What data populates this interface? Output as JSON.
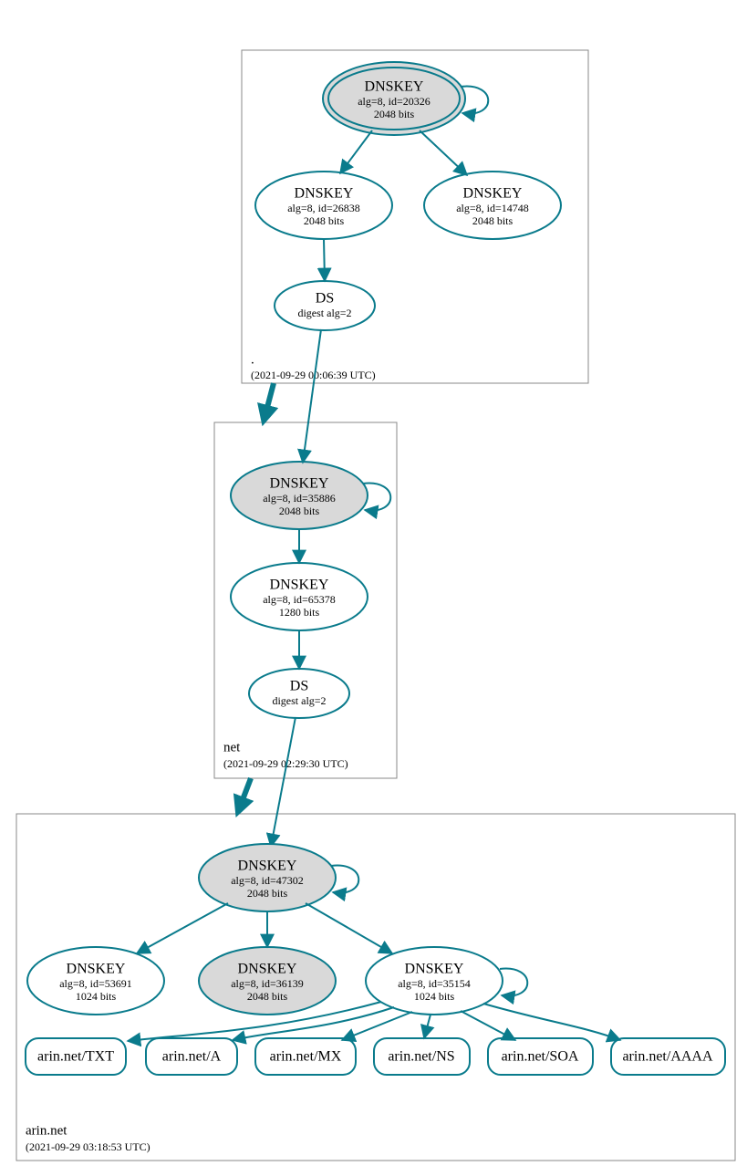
{
  "zones": {
    "root": {
      "name": ".",
      "timestamp": "(2021-09-29 00:06:39 UTC)"
    },
    "net": {
      "name": "net",
      "timestamp": "(2021-09-29 02:29:30 UTC)"
    },
    "arin": {
      "name": "arin.net",
      "timestamp": "(2021-09-29 03:18:53 UTC)"
    }
  },
  "nodes": {
    "root_ksk": {
      "title": "DNSKEY",
      "sub1": "alg=8, id=20326",
      "sub2": "2048 bits"
    },
    "root_zsk": {
      "title": "DNSKEY",
      "sub1": "alg=8, id=26838",
      "sub2": "2048 bits"
    },
    "root_other": {
      "title": "DNSKEY",
      "sub1": "alg=8, id=14748",
      "sub2": "2048 bits"
    },
    "root_ds": {
      "title": "DS",
      "sub1": "digest alg=2"
    },
    "net_ksk": {
      "title": "DNSKEY",
      "sub1": "alg=8, id=35886",
      "sub2": "2048 bits"
    },
    "net_zsk": {
      "title": "DNSKEY",
      "sub1": "alg=8, id=65378",
      "sub2": "1280 bits"
    },
    "net_ds": {
      "title": "DS",
      "sub1": "digest alg=2"
    },
    "arin_ksk": {
      "title": "DNSKEY",
      "sub1": "alg=8, id=47302",
      "sub2": "2048 bits"
    },
    "arin_k1": {
      "title": "DNSKEY",
      "sub1": "alg=8, id=53691",
      "sub2": "1024 bits"
    },
    "arin_k2": {
      "title": "DNSKEY",
      "sub1": "alg=8, id=36139",
      "sub2": "2048 bits"
    },
    "arin_k3": {
      "title": "DNSKEY",
      "sub1": "alg=8, id=35154",
      "sub2": "1024 bits"
    }
  },
  "rr": {
    "txt": "arin.net/TXT",
    "a": "arin.net/A",
    "mx": "arin.net/MX",
    "ns": "arin.net/NS",
    "soa": "arin.net/SOA",
    "aaaa": "arin.net/AAAA"
  },
  "colors": {
    "stroke": "#0a7b8c",
    "shade": "#d9d9d9"
  }
}
